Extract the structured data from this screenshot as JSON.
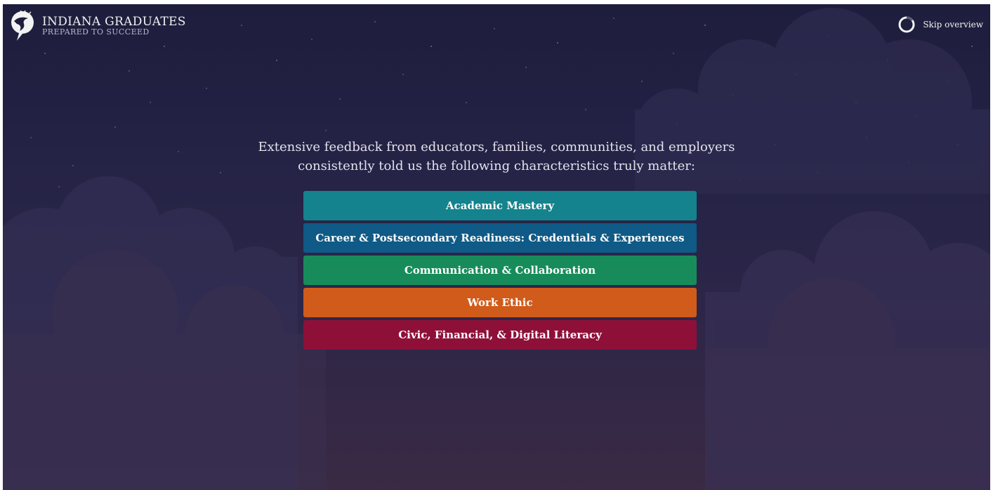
{
  "header": {
    "logo_title": "INDIANA GRADUATES",
    "logo_subtitle": "PREPARED TO SUCCEED",
    "logo_icon": "torch-bird-logo-icon"
  },
  "skip": {
    "label": "Skip overview",
    "icon": "progress-ring-icon"
  },
  "intro": {
    "line1": "Extensive feedback from educators, families, communities, and employers",
    "line2": "consistently told us the following characteristics truly matter:"
  },
  "characteristics": [
    {
      "label": "Academic Mastery",
      "color": "#14838d"
    },
    {
      "label": "Career & Postsecondary Readiness: Credentials & Experiences",
      "color": "#0f5a86"
    },
    {
      "label": "Communication & Collaboration",
      "color": "#178c5a"
    },
    {
      "label": "Work Ethic",
      "color": "#d05b1a"
    },
    {
      "label": "Civic, Financial, & Digital Literacy",
      "color": "#8e1039"
    }
  ],
  "colors": {
    "background_top": "#1e1d3d",
    "background_bottom": "#3a2a44",
    "text": "#e4e2ec"
  }
}
